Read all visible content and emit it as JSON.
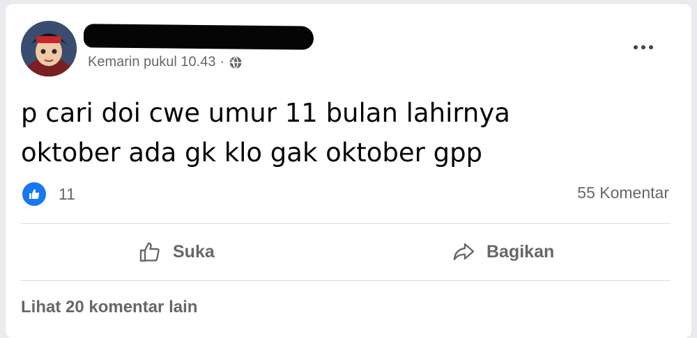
{
  "post": {
    "author_name": "",
    "timestamp": "Kemarin pukul 10.43",
    "separator": "·",
    "privacy_icon": "globe-icon",
    "menu_icon": "more-options-icon",
    "text": "p cari doi cwe umur 11 bulan lahirnya\noktober ada gk klo gak oktober gpp"
  },
  "stats": {
    "reaction_icon": "like-reaction-icon",
    "reaction_count": "11",
    "comments_label": "55 Komentar"
  },
  "actions": {
    "like_label": "Suka",
    "like_icon": "thumbs-up-icon",
    "share_label": "Bagikan",
    "share_icon": "share-arrow-icon"
  },
  "comments": {
    "more_label": "Lihat 20 komentar lain"
  },
  "colors": {
    "accent": "#1877f2",
    "secondary_text": "#65676b",
    "primary_text": "#050505"
  }
}
